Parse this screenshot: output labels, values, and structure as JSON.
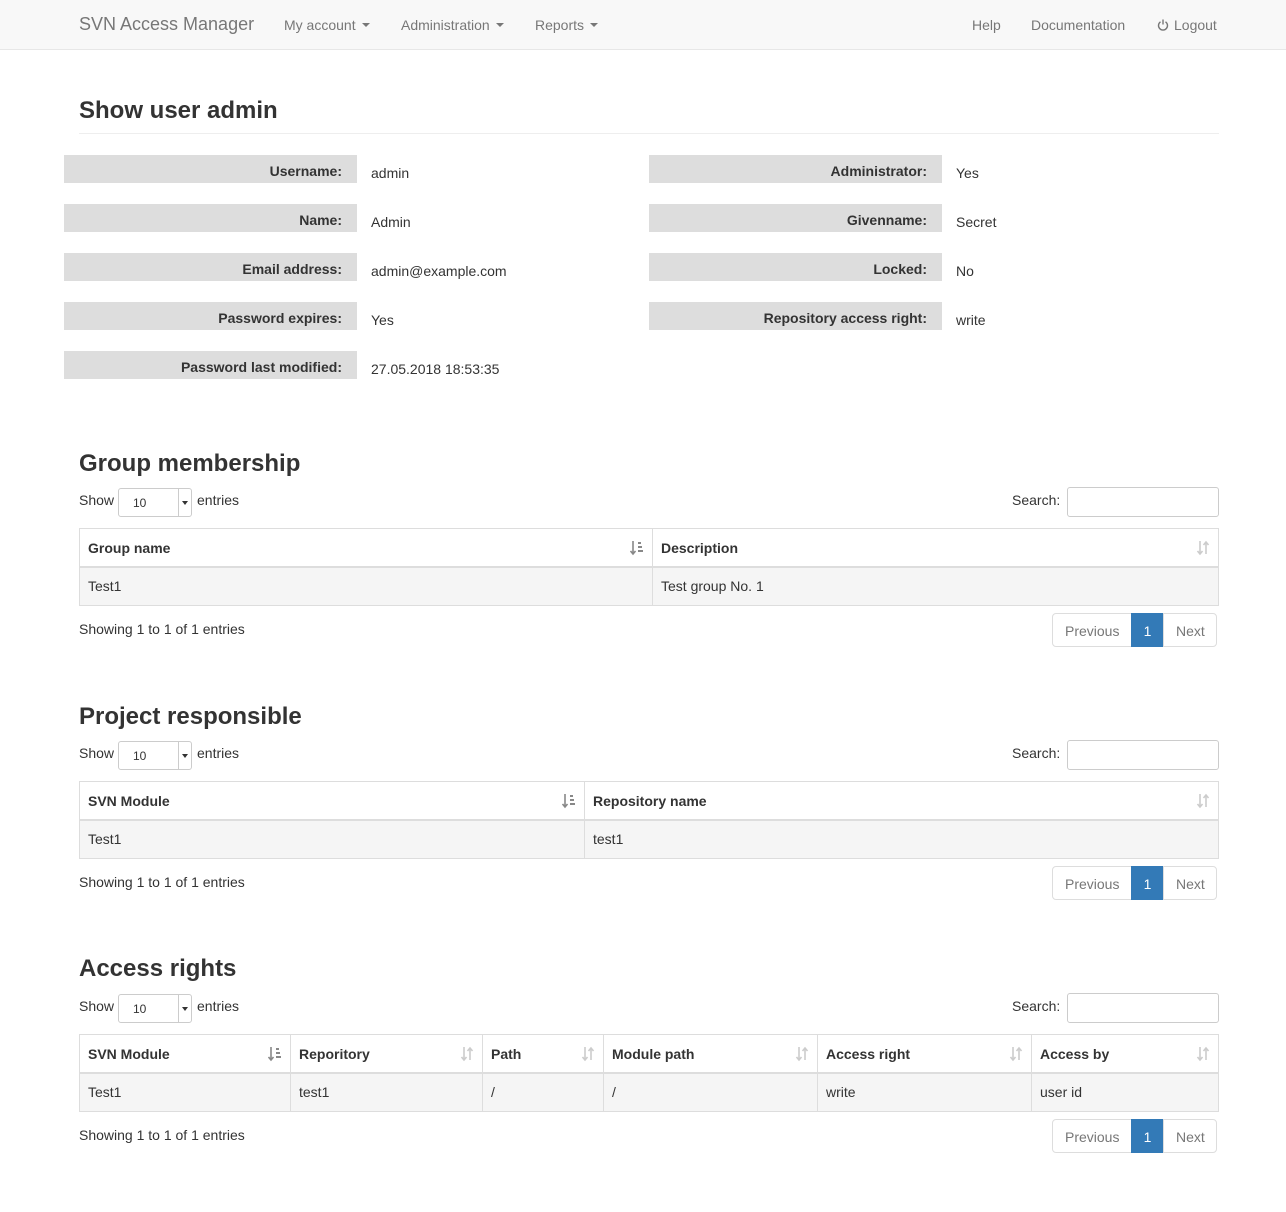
{
  "navbar": {
    "brand": "SVN Access Manager",
    "my_account": "My account",
    "administration": "Administration",
    "reports": "Reports",
    "help": "Help",
    "documentation": "Documentation",
    "logout": "Logout"
  },
  "page_title": "Show user admin",
  "details": {
    "username_label": "Username:",
    "username": "admin",
    "name_label": "Name:",
    "name": "Admin",
    "email_label": "Email address:",
    "email": "admin@example.com",
    "pw_expires_label": "Password expires:",
    "pw_expires": "Yes",
    "pw_modified_label": "Password last modified:",
    "pw_modified": "27.05.2018 18:53:35",
    "admin_label": "Administrator:",
    "admin": "Yes",
    "givenname_label": "Givenname:",
    "givenname": "Secret",
    "locked_label": "Locked:",
    "locked": "No",
    "repo_right_label": "Repository access right:",
    "repo_right": "write"
  },
  "common": {
    "show": "Show",
    "entries": "entries",
    "page_len": "10",
    "search": "Search:",
    "previous": "Previous",
    "page": "1",
    "next": "Next"
  },
  "groups": {
    "title": "Group membership",
    "columns": [
      "Group name",
      "Description"
    ],
    "rows": [
      [
        "Test1",
        "Test group No. 1"
      ]
    ],
    "info": "Showing 1 to 1 of 1 entries"
  },
  "projects": {
    "title": "Project responsible",
    "columns": [
      "SVN Module",
      "Repository name"
    ],
    "rows": [
      [
        "Test1",
        "test1"
      ]
    ],
    "info": "Showing 1 to 1 of 1 entries"
  },
  "access": {
    "title": "Access rights",
    "columns": [
      "SVN Module",
      "Reporitory",
      "Path",
      "Module path",
      "Access right",
      "Access by"
    ],
    "rows": [
      [
        "Test1",
        "test1",
        "/",
        "/",
        "write",
        "user id"
      ]
    ],
    "info": "Showing 1 to 1 of 1 entries"
  },
  "colors": {
    "primary": "#337ab7",
    "label_bg": "#dddddd",
    "row_bg": "#f5f5f5"
  }
}
